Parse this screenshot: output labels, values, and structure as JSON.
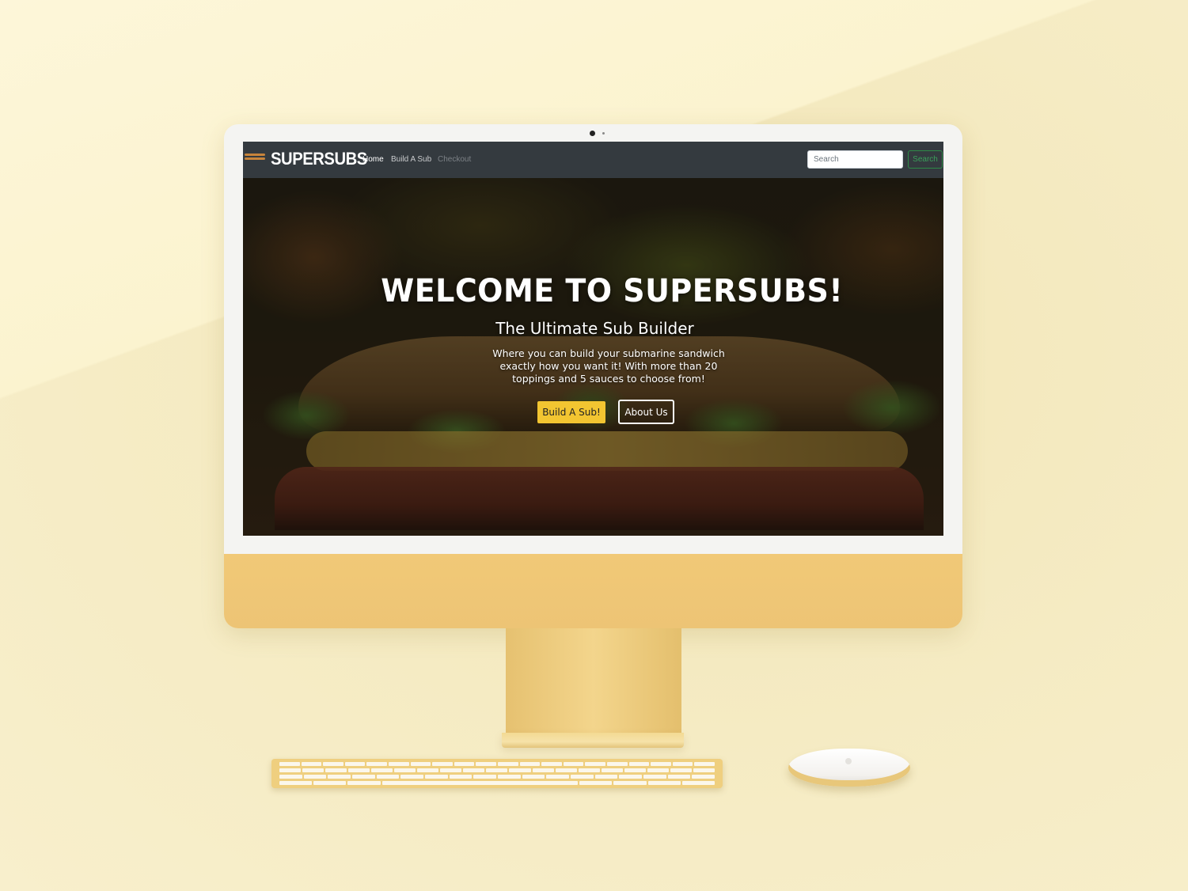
{
  "navbar": {
    "brand": "SUPERSUBS",
    "links": [
      "Home",
      "Build A Sub",
      "Checkout"
    ],
    "search_placeholder": "Search",
    "search_button": "Search"
  },
  "hero": {
    "title": "WELCOME TO SUPERSUBS!",
    "subtitle": "The Ultimate Sub Builder",
    "description": "Where you can build your submarine sandwich exactly how you want it! With more than 20 toppings and 5 sauces to choose from!",
    "primary_button": "Build A Sub!",
    "secondary_button": "About Us"
  },
  "colors": {
    "navbar_bg": "#343a3f",
    "primary_button": "#f2c531",
    "search_button": "#3aa05a",
    "device_accent": "#f1c977"
  }
}
